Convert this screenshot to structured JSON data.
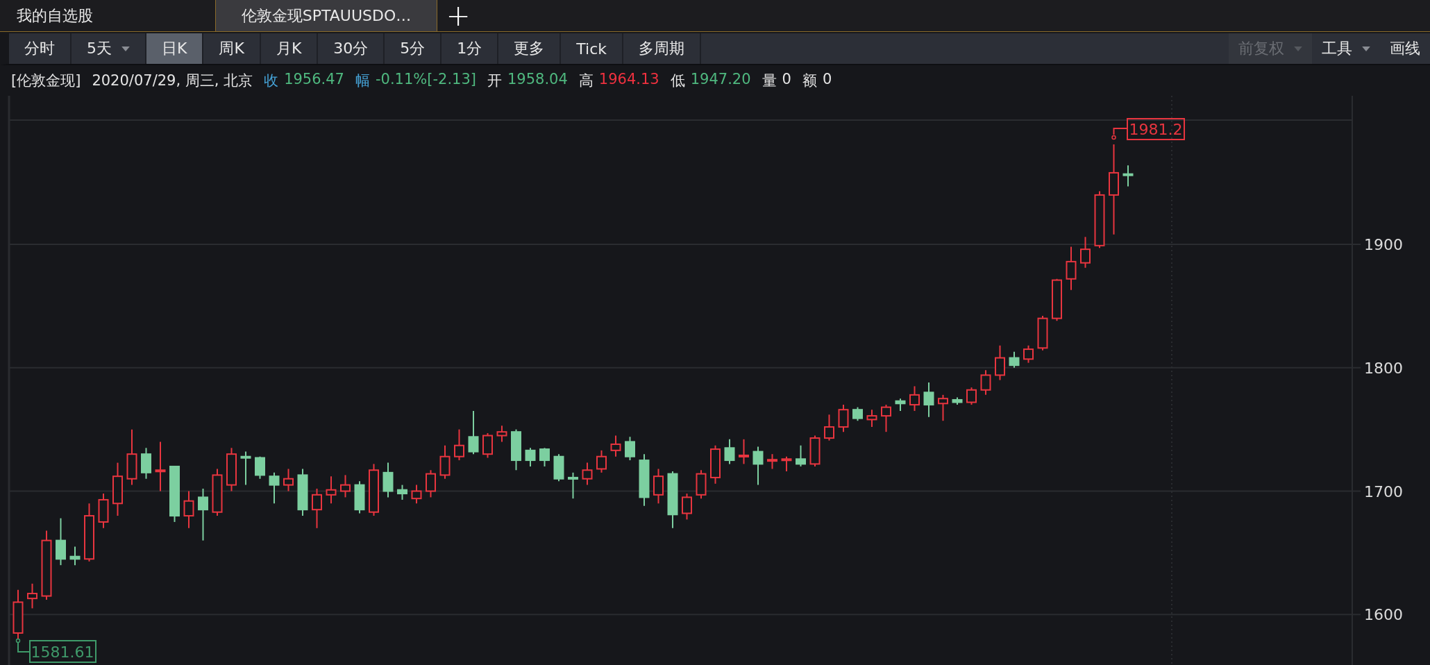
{
  "tabs": [
    {
      "label": "我的自选股",
      "selected": false
    },
    {
      "label": "伦敦金现SPTAUUSDO…",
      "selected": true
    }
  ],
  "add_tab": "+",
  "toolbar": {
    "periods": [
      {
        "label": "分时",
        "selected": false,
        "dropdown": false
      },
      {
        "label": "5天",
        "selected": false,
        "dropdown": true
      },
      {
        "label": "日K",
        "selected": true,
        "dropdown": false
      },
      {
        "label": "周K",
        "selected": false,
        "dropdown": false
      },
      {
        "label": "月K",
        "selected": false,
        "dropdown": false
      },
      {
        "label": "30分",
        "selected": false,
        "dropdown": false
      },
      {
        "label": "5分",
        "selected": false,
        "dropdown": false
      },
      {
        "label": "1分",
        "selected": false,
        "dropdown": false
      },
      {
        "label": "更多",
        "selected": false,
        "dropdown": false
      },
      {
        "label": "Tick",
        "selected": false,
        "dropdown": false
      },
      {
        "label": "多周期",
        "selected": false,
        "dropdown": false
      }
    ],
    "options": [
      {
        "label": "前复权",
        "disabled": true,
        "dropdown": true
      },
      {
        "label": "工具",
        "disabled": false,
        "dropdown": true
      },
      {
        "label": "画线",
        "disabled": false,
        "dropdown": false
      }
    ]
  },
  "quote": {
    "symbol": "[伦敦金现]",
    "datetime": "2020/07/29, 周三, 北京",
    "fields": [
      {
        "label": "收",
        "label_highlight": true,
        "value": "1956.47",
        "color": "#4fb87f"
      },
      {
        "label": "幅",
        "label_highlight": true,
        "value": "-0.11%[-2.13]",
        "color": "#4fb87f"
      },
      {
        "label": "开",
        "label_highlight": false,
        "value": "1958.04",
        "color": "#4fb87f"
      },
      {
        "label": "高",
        "label_highlight": false,
        "value": "1964.13",
        "color": "#f0313f"
      },
      {
        "label": "低",
        "label_highlight": false,
        "value": "1947.20",
        "color": "#4fb87f"
      },
      {
        "label": "量",
        "label_highlight": false,
        "value": "0",
        "color": "#e4e4e4"
      },
      {
        "label": "额",
        "label_highlight": false,
        "value": "0",
        "color": "#e4e4e4"
      }
    ]
  },
  "chart": {
    "axis_labels": [
      "1900",
      "1800",
      "1700",
      "1600"
    ],
    "high_marker": "1981.2",
    "low_marker": "1581.61"
  }
}
